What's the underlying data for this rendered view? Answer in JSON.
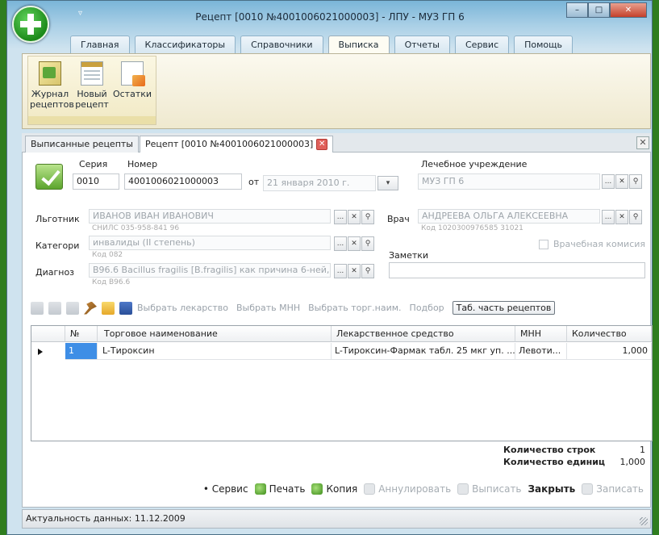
{
  "window": {
    "title": "Рецепт [0010 №4001006021000003] - ЛПУ - МУЗ ГП 6",
    "qat_glyph": "▿",
    "buttons": {
      "minimize": "–",
      "maximize": "□",
      "close": "✕"
    }
  },
  "ribbon": {
    "tabs": [
      "Главная",
      "Классификаторы",
      "Справочники",
      "Выписка",
      "Отчеты",
      "Сервис",
      "Помощь"
    ],
    "active_tab": "Выписка",
    "buttons": [
      {
        "label": "Журнал рецептов",
        "icon": "journal-icon"
      },
      {
        "label": "Новый рецепт",
        "icon": "new-prescription-icon"
      },
      {
        "label": "Остатки",
        "icon": "stock-icon"
      }
    ]
  },
  "doc_tabs": {
    "tab1": "Выписанные рецепты",
    "tab2": "Рецепт [0010 №4001006021000003]",
    "close_glyph": "✕",
    "pane_close": "✕"
  },
  "form": {
    "series_label": "Серия",
    "series_value": "0010",
    "number_label": "Номер",
    "number_value": "4001006021000003",
    "from_label": "от",
    "date_value": "21  января  2010 г.",
    "institution_label": "Лечебное учреждение",
    "institution_value": "МУЗ ГП 6",
    "beneficiary_label": "Льготник",
    "beneficiary_value": "ИВАНОВ ИВАН ИВАНОВИЧ",
    "beneficiary_sub": "СНИЛС 035-958-841 96",
    "doctor_label": "Врач",
    "doctor_value": "АНДРЕЕВА ОЛЬГА АЛЕКСЕЕВНА",
    "doctor_sub": "Код 1020300976585 31021",
    "category_label": "Категори",
    "category_value": "инвалиды (II степень)",
    "category_sub": "Код 082",
    "commission_label": "Врачебная комисия",
    "notes_label": "Заметки",
    "notes_value": "",
    "diagnosis_label": "Диагноз",
    "diagnosis_value": "B96.6 Bacillus fragilis [B.fragilis] как причина 6-ней, кл.е",
    "diagnosis_sub": "Код B96.6",
    "lookup": {
      "ellipsis": "...",
      "clear": "✕",
      "search": "⚲",
      "dropdown": "▾"
    }
  },
  "toolbar": {
    "links": [
      "Выбрать лекарство",
      "Выбрать МНН",
      "Выбрать торг.наим.",
      "Подбор"
    ],
    "active": "Таб. часть рецептов"
  },
  "grid": {
    "columns": [
      "№",
      "Торговое наименование",
      "Лекарственное средство",
      "МНН",
      "Количество"
    ],
    "rows": [
      [
        "1",
        "L-Тироксин",
        "L-Тироксин-Фармак табл. 25 мкг уп. ...",
        "Левоти...",
        "1,000"
      ]
    ]
  },
  "summary": {
    "rows_label": "Количество строк",
    "rows_value": "1",
    "units_label": "Количество единиц",
    "units_value": "1,000"
  },
  "actions": {
    "service": "• Сервис",
    "print": "Печать",
    "copy": "Копия",
    "cancel": "Аннулировать",
    "issue": "Выписать",
    "close": "Закрыть",
    "save": "Записать"
  },
  "status": {
    "text": "Актуальность данных: 11.12.2009"
  }
}
